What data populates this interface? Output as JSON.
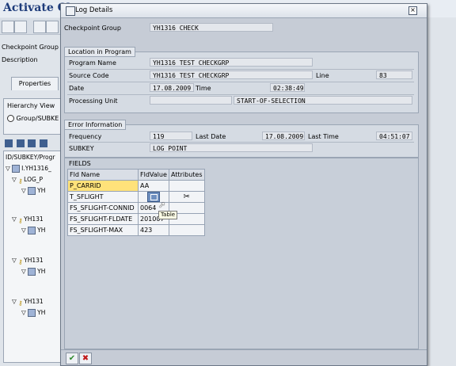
{
  "background": {
    "title": "Activate Che",
    "label_checkpoint_group": "Checkpoint Group",
    "label_description": "Description",
    "tab_properties": "Properties",
    "hierarchy_view": "Hierarchy View",
    "radio_group_subkey": "Group/SUBKE",
    "tree_header": "ID/SUBKEY/Progr",
    "tree_items": [
      "I.YH1316_",
      "LOG_P",
      "YH",
      "YH131",
      "YH",
      "YH131",
      "YH",
      "YH131",
      "YH"
    ]
  },
  "dialog": {
    "title": "Log Details",
    "checkpoint_group_label": "Checkpoint Group",
    "checkpoint_group_value": "YH1316_CHECK",
    "location": {
      "title": "Location in Program",
      "program_name_label": "Program Name",
      "program_name_value": "YH1316_TEST_CHECKGRP",
      "source_code_label": "Source Code",
      "source_code_value": "YH1316_TEST_CHECKGRP",
      "line_label": "Line",
      "line_value": "83",
      "date_label": "Date",
      "date_value": "17.08.2009",
      "time_label": "Time",
      "time_value": "02:38:49",
      "processing_unit_label": "Processing Unit",
      "processing_unit_value": "START-OF-SELECTION"
    },
    "error": {
      "title": "Error Information",
      "frequency_label": "Frequency",
      "frequency_value": "119",
      "last_date_label": "Last Date",
      "last_date_value": "17.08.2009",
      "last_time_label": "Last Time",
      "last_time_value": "04:51:07",
      "subkey_label": "SUBKEY",
      "subkey_value": "LOG_POINT"
    },
    "fields": {
      "title": "FIELDS",
      "columns": [
        "Fld Name",
        "FldValue",
        "Attributes"
      ],
      "rows": [
        {
          "name": "P_CARRID",
          "value": "AA"
        },
        {
          "name": "T_SFLIGHT",
          "value": ""
        },
        {
          "name": "FS_SFLIGHT-CONNID",
          "value": "0064"
        },
        {
          "name": "FS_SFLIGHT-FLDATE",
          "value": "201007"
        },
        {
          "name": "FS_SFLIGHT-MAX",
          "value": "423"
        }
      ],
      "tooltip": "Table"
    }
  }
}
